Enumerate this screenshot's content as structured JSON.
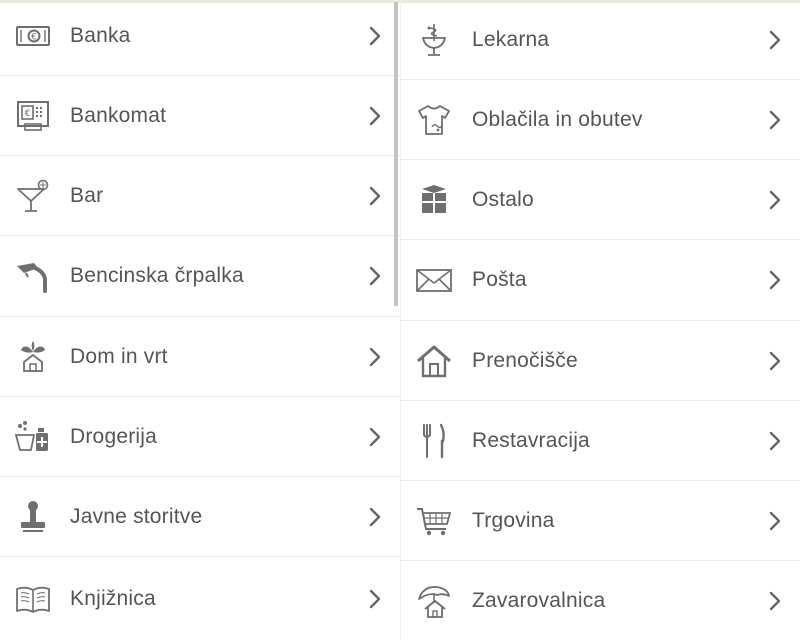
{
  "left": [
    {
      "label": "Banka",
      "icon": "banknote-icon"
    },
    {
      "label": "Bankomat",
      "icon": "atm-icon"
    },
    {
      "label": "Bar",
      "icon": "cocktail-glass-icon"
    },
    {
      "label": "Bencinska črpalka",
      "icon": "fuel-nozzle-icon"
    },
    {
      "label": "Dom in vrt",
      "icon": "house-plant-icon"
    },
    {
      "label": "Drogerija",
      "icon": "cosmetics-icon"
    },
    {
      "label": "Javne storitve",
      "icon": "stamp-icon"
    },
    {
      "label": "Knjižnica",
      "icon": "open-book-icon"
    }
  ],
  "right": [
    {
      "label": "Lekarna",
      "icon": "pharmacy-icon"
    },
    {
      "label": "Oblačila in obutev",
      "icon": "tshirt-icon"
    },
    {
      "label": "Ostalo",
      "icon": "boxes-icon"
    },
    {
      "label": "Pošta",
      "icon": "envelope-icon"
    },
    {
      "label": "Prenočišče",
      "icon": "house-icon"
    },
    {
      "label": "Restavracija",
      "icon": "fork-knife-icon"
    },
    {
      "label": "Trgovina",
      "icon": "shopping-cart-icon"
    },
    {
      "label": "Zavarovalnica",
      "icon": "umbrella-house-icon"
    }
  ],
  "colors": {
    "icon": "#6f6f6f",
    "text": "#555555",
    "chevron": "#666666",
    "divider": "#ececec"
  }
}
